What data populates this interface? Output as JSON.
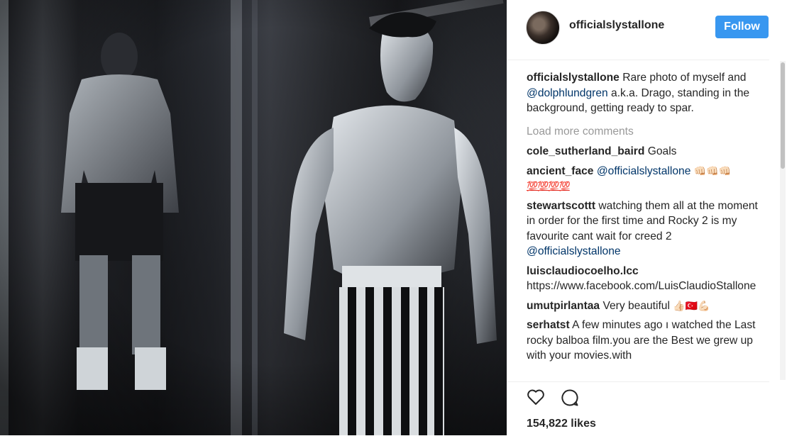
{
  "post": {
    "username": "officialslystallone",
    "follow_label": "Follow",
    "caption": {
      "user": "officialslystallone",
      "text_before": " Rare photo of myself and ",
      "mention": "@dolphlundgren",
      "text_after": " a.k.a. Drago, standing in the background, getting ready to spar."
    },
    "load_more": "Load more comments",
    "comments": [
      {
        "user": "cole_sutherland_baird",
        "text": " Goals"
      },
      {
        "user": "ancient_face",
        "mention": "@officialslystallone",
        "emoji": "👊🏻👊🏻👊🏻",
        "hundreds": "💯💯💯💯"
      },
      {
        "user": "stewartscottt",
        "text": " watching them all at the moment in order for the first time and Rocky 2 is my favourite cant wait for creed 2 ",
        "mention": "@officialslystallone"
      },
      {
        "user": "luisclaudiocoelho.lcc",
        "text": " https://www.facebook.com/LuisClaudioStallone"
      },
      {
        "user": "umutpirlantaa",
        "text": " Very beautiful ",
        "emoji": "👍🏻🇹🇷💪🏻"
      },
      {
        "user": "serhatst",
        "text": " A few minutes ago ı watched the Last rocky balboa film.you are the Best we grew up with your movies.with"
      }
    ],
    "likes": "154,822 likes",
    "icons": {
      "like": "heart-icon",
      "comment": "comment-icon"
    }
  }
}
